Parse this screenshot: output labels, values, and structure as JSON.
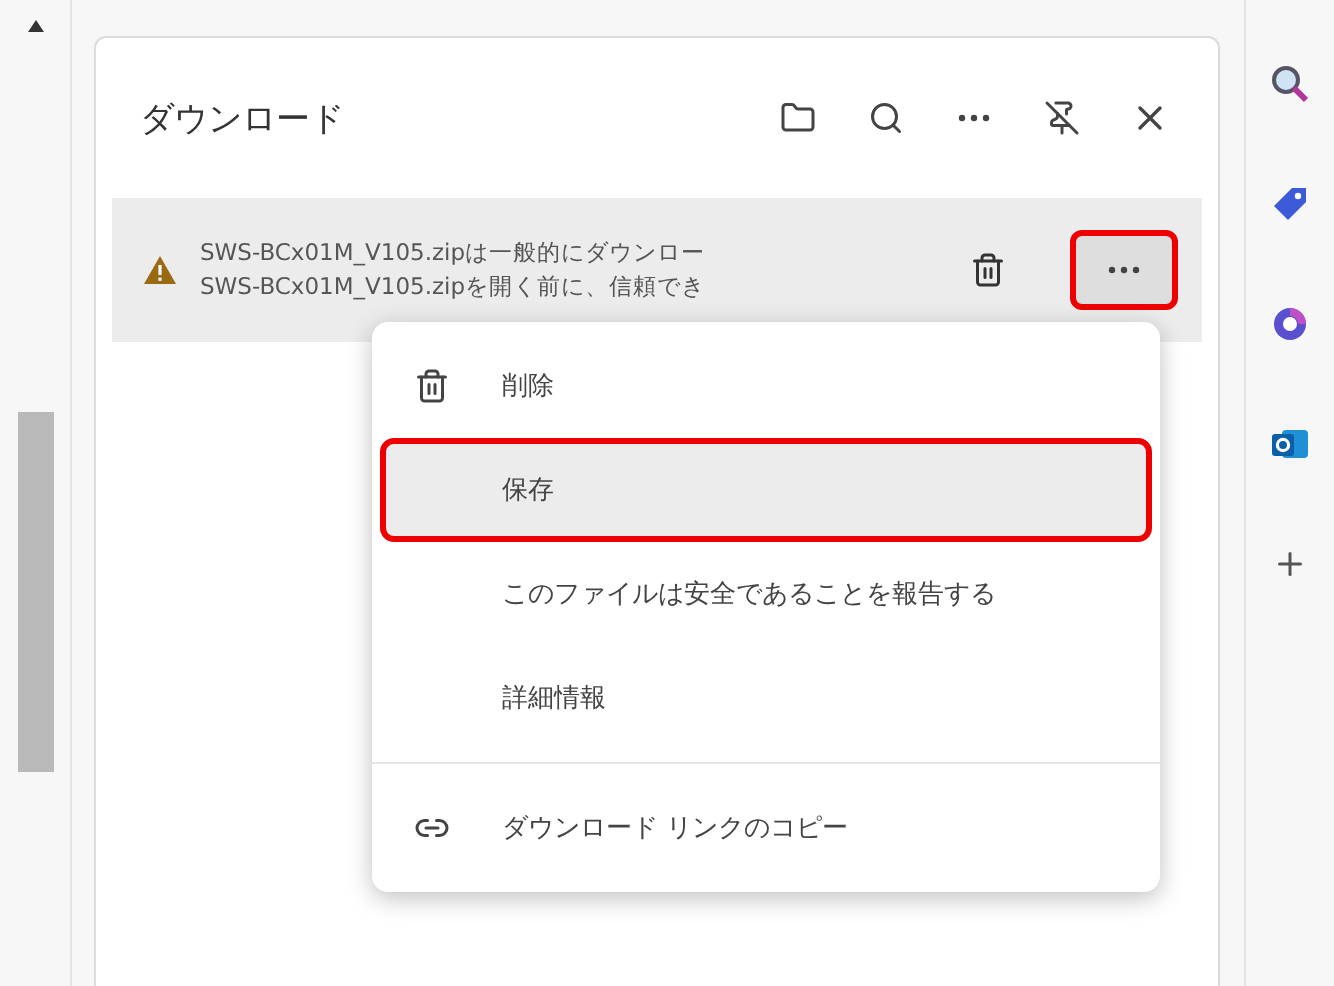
{
  "panel": {
    "title": "ダウンロード"
  },
  "header_buttons": [
    {
      "kind": "folder"
    },
    {
      "kind": "search"
    },
    {
      "kind": "more"
    },
    {
      "kind": "unpin"
    },
    {
      "kind": "close"
    }
  ],
  "download": {
    "lines": [
      "SWS-BCx01M_V105.zipは一般的にダウンロー",
      "SWS-BCx01M_V105.zipを開く前に、信頼でき"
    ],
    "more_highlighted": true
  },
  "menu": [
    {
      "kind": "delete",
      "label": "削除",
      "highlighted": false
    },
    {
      "kind": "plain",
      "label": "保存",
      "highlighted": true
    },
    {
      "kind": "plain",
      "label": "このファイルは安全であることを報告する",
      "highlighted": false
    },
    {
      "kind": "plain",
      "label": "詳細情報",
      "highlighted": false
    },
    {
      "kind": "divider"
    },
    {
      "kind": "link",
      "label": "ダウンロード リンクのコピー",
      "highlighted": false
    }
  ],
  "sidebar": [
    {
      "kind": "search"
    },
    {
      "kind": "tag"
    },
    {
      "kind": "copilot"
    },
    {
      "kind": "outlook"
    },
    {
      "kind": "add"
    }
  ]
}
